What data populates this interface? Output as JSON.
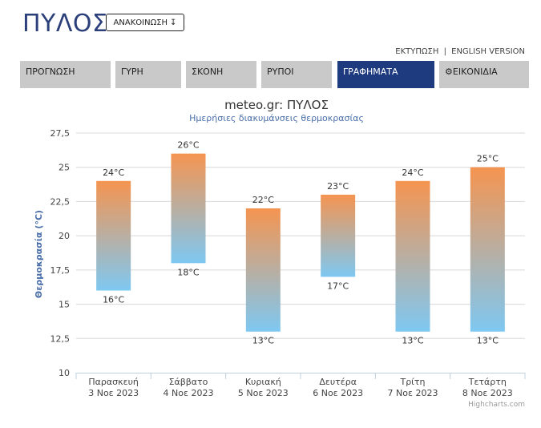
{
  "header": {
    "title": "ΠΥΛΟΣ",
    "announcement_label": "ΑΝΑΚΟΙΝΩΣΗ",
    "announcement_icon": "arrow-down-icon",
    "print_link": "ΕΚΤΥΠΩΣΗ",
    "separator": "|",
    "english_link": "ENGLISH VERSION"
  },
  "tabs": [
    {
      "label": "ΠΡΟΓΝΩΣΗ",
      "active": false
    },
    {
      "label": "ΓΥΡΗ",
      "active": false
    },
    {
      "label": "ΣΚΟΝΗ",
      "active": false
    },
    {
      "label": "ΡΥΠΟΙ",
      "active": false
    },
    {
      "label": "ΓΡΑΦΗΜΑΤΑ",
      "active": true
    },
    {
      "label": "ΕΙΚΟΝΙΔΙΑ",
      "active": false,
      "icon": "gear-icon"
    }
  ],
  "colors": {
    "accent": "#1f3b80",
    "bar_top": "#f59450",
    "bar_bottom": "#7ec8f2",
    "axis_title": "#4a6ea9",
    "subtitle": "#4a6ea9"
  },
  "chart_data": {
    "type": "columnrange",
    "title": "meteo.gr: ΠΥΛΟΣ",
    "subtitle": "Ημερήσιες διακυμάνσεις θερμοκρασίας",
    "ylabel": "Θερμοκρασία (°C)",
    "unit": "°C",
    "ylim": [
      10,
      27.5
    ],
    "yticks": [
      "10",
      "12,5",
      "15",
      "17,5",
      "20",
      "22,5",
      "25",
      "27,5"
    ],
    "ytick_values": [
      10,
      12.5,
      15,
      17.5,
      20,
      22.5,
      25,
      27.5
    ],
    "grid": true,
    "categories": [
      {
        "day": "Παρασκευή",
        "date": "3 Νοε 2023"
      },
      {
        "day": "Σάββατο",
        "date": "4 Νοε 2023"
      },
      {
        "day": "Κυριακή",
        "date": "5 Νοε 2023"
      },
      {
        "day": "Δευτέρα",
        "date": "6 Νοε 2023"
      },
      {
        "day": "Τρίτη",
        "date": "7 Νοε 2023"
      },
      {
        "day": "Τετάρτη",
        "date": "8 Νοε 2023"
      }
    ],
    "series": [
      {
        "low": [
          16,
          18,
          13,
          17,
          13,
          13
        ],
        "high": [
          24,
          26,
          22,
          23,
          24,
          25
        ]
      }
    ],
    "credits": "Highcharts.com"
  }
}
